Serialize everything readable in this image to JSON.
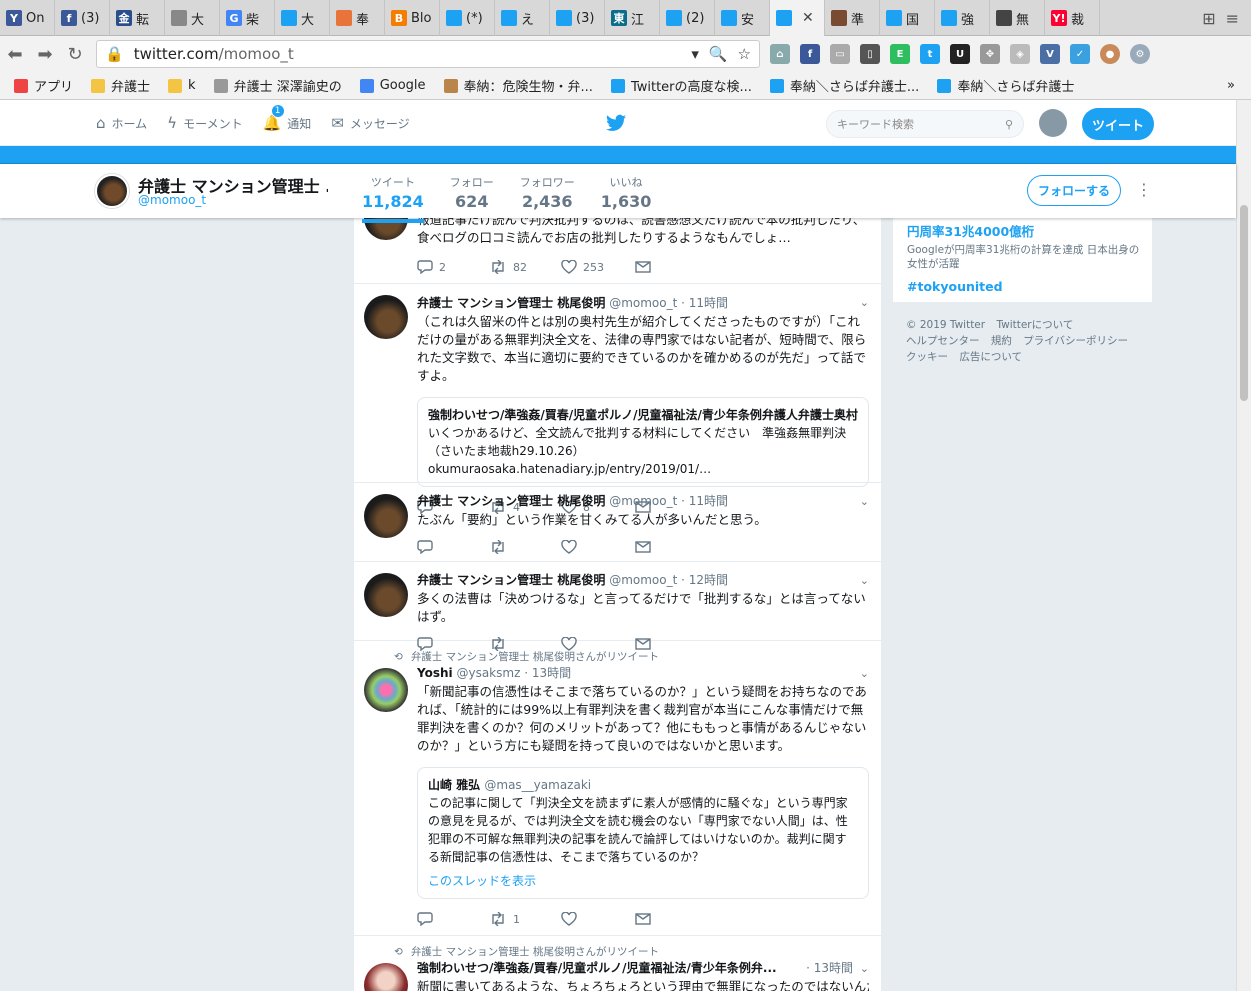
{
  "browser": {
    "tabs": [
      {
        "label": "On",
        "color": "#3b5998",
        "glyph": "Y"
      },
      {
        "label": "(3)",
        "color": "#3b5998",
        "glyph": "f"
      },
      {
        "label": "転",
        "color": "#2a4d8c",
        "glyph": "金"
      },
      {
        "label": "大",
        "color": "#888888",
        "glyph": ""
      },
      {
        "label": "柴",
        "color": "#4285f4",
        "glyph": "G"
      },
      {
        "label": "大",
        "color": "#1da1f2",
        "glyph": ""
      },
      {
        "label": "奉",
        "color": "#e8743b",
        "glyph": ""
      },
      {
        "label": "Blo",
        "color": "#f57d00",
        "glyph": "B"
      },
      {
        "label": "(*)",
        "color": "#1da1f2",
        "glyph": ""
      },
      {
        "label": "え",
        "color": "#1da1f2",
        "glyph": ""
      },
      {
        "label": "(3)",
        "color": "#1da1f2",
        "glyph": ""
      },
      {
        "label": "江",
        "color": "#0a6d8c",
        "glyph": "東"
      },
      {
        "label": "(2)",
        "color": "#1da1f2",
        "glyph": ""
      },
      {
        "label": "安",
        "color": "#1da1f2",
        "glyph": ""
      },
      {
        "label": "",
        "color": "#1da1f2",
        "glyph": "",
        "active": true
      },
      {
        "label": "準",
        "color": "#7a4b33",
        "glyph": ""
      },
      {
        "label": "国",
        "color": "#1da1f2",
        "glyph": ""
      },
      {
        "label": "強",
        "color": "#1da1f2",
        "glyph": ""
      },
      {
        "label": "無",
        "color": "#444444",
        "glyph": ""
      },
      {
        "label": "裁",
        "color": "#ff0033",
        "glyph": "Y!"
      }
    ],
    "url_host": "twitter.com",
    "url_path": "/momoo_t",
    "bookmarks": [
      {
        "label": "アプリ"
      },
      {
        "label": "弁護士"
      },
      {
        "label": "k"
      },
      {
        "label": "弁護士 深澤諭史の"
      },
      {
        "label": "Google"
      },
      {
        "label": "奉納：危険生物・弁..."
      },
      {
        "label": "Twitterの高度な検..."
      },
      {
        "label": "奉納＼さらば弁護士..."
      },
      {
        "label": "奉納＼さらば弁護士"
      }
    ]
  },
  "topbar": {
    "home": "ホーム",
    "moments": "モーメント",
    "notifications": "通知",
    "notif_count": "1",
    "messages": "メッセージ",
    "search_placeholder": "キーワード検索",
    "tweet_button": "ツイート"
  },
  "profile": {
    "name": "弁護士 マンション管理士 ...",
    "handle": "@momoo_t",
    "stats": [
      {
        "label": "ツイート",
        "value": "11,824"
      },
      {
        "label": "フォロー",
        "value": "624"
      },
      {
        "label": "フォロワー",
        "value": "2,436"
      },
      {
        "label": "いいね",
        "value": "1,630"
      }
    ],
    "follow_button": "フォローする"
  },
  "tweets": {
    "t0": {
      "text": "報道記事だけ読んで判決批判するのは、読書感想文だけ読んで本の批判したり、食べログの口コミ読んでお店の批判したりするようなもんでしょ…",
      "replies": "2",
      "retweets": "82",
      "likes": "253"
    },
    "t1": {
      "name": "弁護士 マンション管理士 桃尾俊明",
      "handle": "@momoo_t",
      "time": "· 11時間",
      "text": "（これは久留米の件とは別の奥村先生が紹介してくださったものですが）「これだけの量がある無罪判決全文を、法律の専門家ではない記者が、短時間で、限られた文字数で、本当に適切に要約できているのかを確かめるのが先だ」って話ですよ。",
      "card_title": "強制わいせつ/準強姦/買春/児童ポルノ/児童福祉法/青少年条例弁護人弁護士奥村",
      "card_desc": "いくつかあるけど、全文読んで批判する材料にしてください　準強姦無罪判決（さいたま地裁h29.10.26）okumuraosaka.hatenadiary.jp/entry/2019/01/…",
      "retweets": "4",
      "likes": "8"
    },
    "t2": {
      "name": "弁護士 マンション管理士 桃尾俊明",
      "handle": "@momoo_t",
      "time": "· 11時間",
      "text": "たぶん「要約」という作業を甘くみてる人が多いんだと思う。"
    },
    "t3": {
      "name": "弁護士 マンション管理士 桃尾俊明",
      "handle": "@momoo_t",
      "time": "· 12時間",
      "text": "多くの法曹は「決めつけるな」と言ってるだけで「批判するな」とは言ってないはず。"
    },
    "t4": {
      "rt_by": "弁護士 マンション管理士 桃尾俊明さんがリツイート",
      "name": "Yoshi",
      "handle": "@ysaksmz",
      "time": "· 13時間",
      "text": "「新聞記事の信憑性はそこまで落ちているのか？」という疑問をお持ちなのであれば、「統計的には99%以上有罪判決を書く裁判官が本当にこんな事情だけで無罪判決を書くのか？何のメリットがあって？他にももっと事情があるんじゃないのか？」という方にも疑問を持って良いのではないかと思います。",
      "quote_name": "山崎 雅弘",
      "quote_handle": "@mas__yamazaki",
      "quote_text": "この記事に関して「判決全文を読まずに素人が感情的に騒ぐな」という専門家の意見を見るが、では判決全文を読む機会のない「専門家でない人間」は、性犯罪の不可解な無罪判決の記事を読んで論評してはいけないのか。裁判に関する新聞記事の信憑性は、そこまで落ちているのか？",
      "quote_thread": "このスレッドを表示",
      "retweets": "1"
    },
    "t5": {
      "rt_by": "弁護士 マンション管理士 桃尾俊明さんがリツイート",
      "name": "強制わいせつ/準強姦/買春/児童ポルノ/児童福祉法/青少年条例弁...",
      "time": "· 13時間",
      "text": "新聞に書いてあるような、ちょろちょろという理由で無罪になったのではないんだ。検察"
    }
  },
  "sidebar": {
    "trend1": "円周率31兆4000億桁",
    "trend1_desc": "Googleが円周率31兆桁の計算を達成 日本出身の女性が活躍",
    "trend2": "#tokyounited"
  },
  "footer": {
    "copyright": "© 2019 Twitter",
    "about": "Twitterについて",
    "help": "ヘルプセンター",
    "terms": "規約",
    "privacy": "プライバシーポリシー",
    "cookies": "クッキー",
    "ads": "広告について"
  },
  "colors": {
    "accent": "#1da1f2",
    "text": "#14171a",
    "muted": "#657786"
  }
}
